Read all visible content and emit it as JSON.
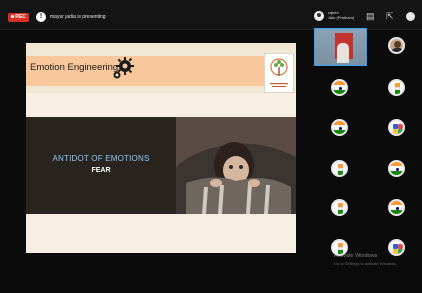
{
  "topbar": {
    "rec_label": "REC",
    "presenter_initial": "!",
    "presenter_text": "mayur jadia is presenting",
    "self_name_line1": "rajeev",
    "self_name_line2": "Jain (Pratham)",
    "icons": [
      "people-icon",
      "expand-icon",
      "profile-icon"
    ]
  },
  "slide": {
    "title": "Emotion Engineering",
    "heading": "ANTIDOT OF EMOTIONS",
    "subheading": "FEAR",
    "colors": {
      "header_band": "#f8c89c",
      "background": "#f1e7d5",
      "heading": "#8cc7ff"
    }
  },
  "participants": [
    {
      "type": "video"
    },
    {
      "type": "photo"
    },
    {
      "type": "flag"
    },
    {
      "type": "mini-flag"
    },
    {
      "type": "flag"
    },
    {
      "type": "multi"
    },
    {
      "type": "mini-flag"
    },
    {
      "type": "flag"
    },
    {
      "type": "mini-flag"
    },
    {
      "type": "flag"
    },
    {
      "type": "mini-flag"
    },
    {
      "type": "multi"
    }
  ],
  "watermark": {
    "line1": "Activate Windows",
    "line2": "Go to Settings to activate Windows."
  }
}
